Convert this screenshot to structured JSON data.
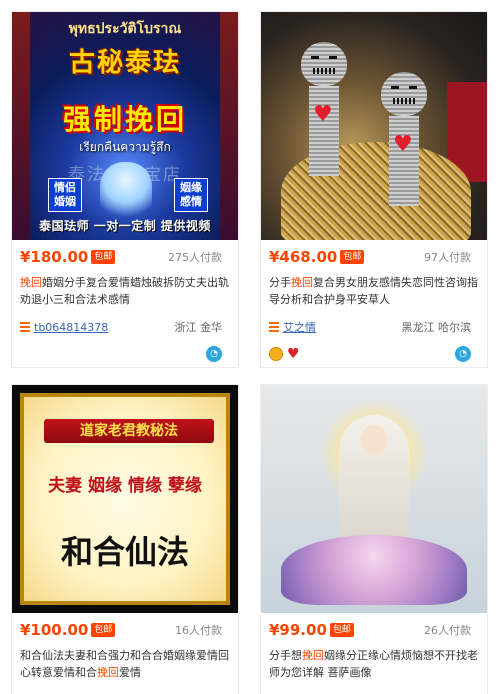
{
  "products": [
    {
      "price": "¥180.00",
      "badge": "包邮",
      "paid": "275人付款",
      "title_hl": "挽回",
      "title_pre": "",
      "title_post": "婚姻分手复合爱情蜡烛破拆防丈夫出轨劝退小三和合法术感情",
      "shop": "tb064814378",
      "location": "浙江 金华",
      "image_text": {
        "thai_top": "พุทธประวัติโบราณ",
        "headline": "古秘泰珐",
        "main": "强制挽回",
        "thai_sub": "เรียกคืนความรู้สึก",
        "watermark": "泰法佛牌宝店",
        "tag_left": "情侣婚姻",
        "tag_right": "姻缘感情",
        "footer": "泰国珐师 一对一定制 提供视频"
      }
    },
    {
      "price": "¥468.00",
      "badge": "包邮",
      "paid": "97人付款",
      "title_pre": "分手",
      "title_hl": "挽回",
      "title_post": "复合男女朋友感情失恋同性咨询指导分析和合护身平安草人",
      "shop": "艾之情",
      "location": "黑龙江 哈尔滨"
    },
    {
      "price": "¥100.00",
      "badge": "包邮",
      "paid": "16人付款",
      "title_pre": "和合仙法夫妻和合强力和合合婚姻缘爱情回心转意爱情和合",
      "title_hl": "挽回",
      "title_post": "爱情",
      "image_text": {
        "banner": "道家老君教秘法",
        "line2": "夫妻 姻缘 情缘 孽缘",
        "line3": "和合仙法"
      }
    },
    {
      "price": "¥99.00",
      "badge": "包邮",
      "paid": "26人付款",
      "title_pre": "分手想",
      "title_hl": "挽回",
      "title_post": "姻缘分正缘心情烦恼想不开找老师为您详解 菩萨画像"
    }
  ],
  "colors": {
    "accent": "#ff4400",
    "link": "#3366bb"
  },
  "icons": {
    "shop": "shop-list-icon",
    "chat": "wangwang-chat-icon",
    "medal": "gold-medal-icon",
    "heart": "heart-icon"
  }
}
